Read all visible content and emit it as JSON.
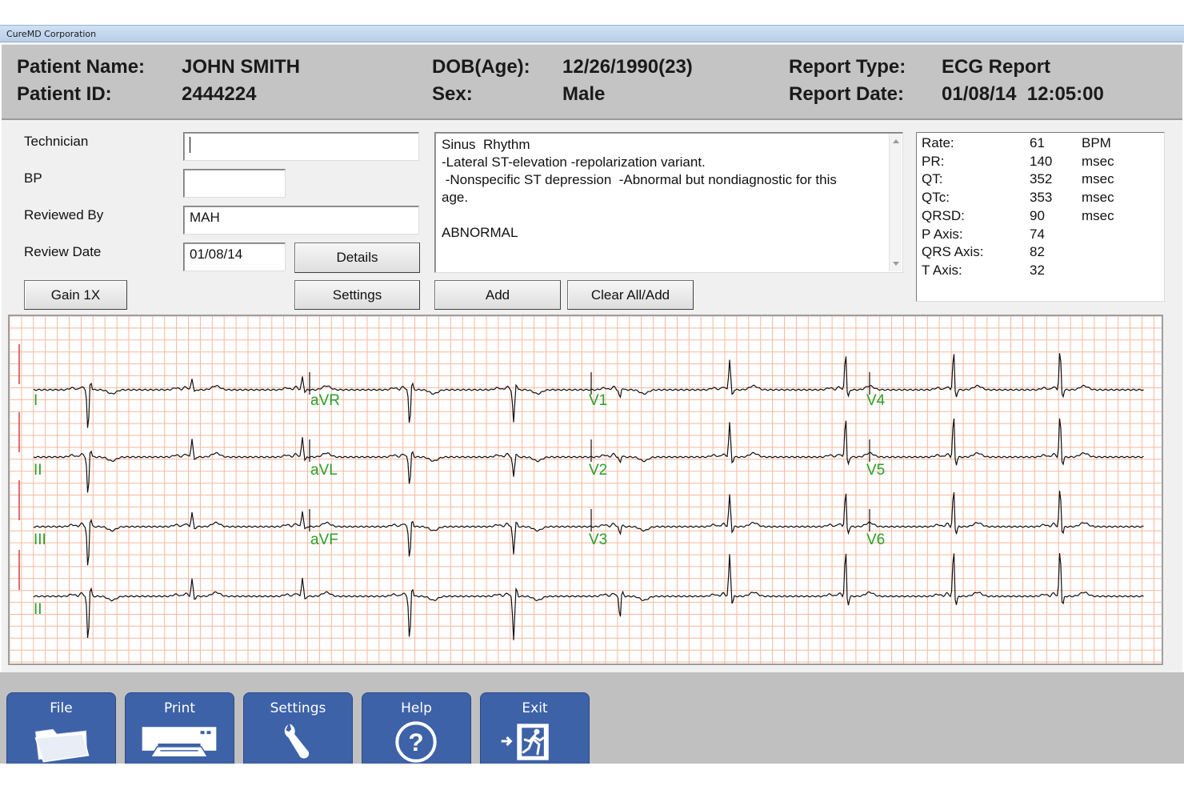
{
  "window": {
    "title": "CureMD Corporation"
  },
  "header": {
    "patient_name_label": "Patient Name:",
    "patient_name": "JOHN SMITH",
    "patient_id_label": "Patient ID:",
    "patient_id": "2444224",
    "dob_label": "DOB(Age):",
    "dob": "12/26/1990(23)",
    "sex_label": "Sex:",
    "sex": "Male",
    "report_type_label": "Report Type:",
    "report_type": "ECG Report",
    "report_date_label": "Report Date:",
    "report_date": "01/08/14  12:05:00"
  },
  "form": {
    "technician_label": "Technician",
    "technician_value": "",
    "bp_label": "BP",
    "bp_value": "",
    "reviewed_by_label": "Reviewed By",
    "reviewed_by_value": "MAH",
    "review_date_label": "Review Date",
    "review_date_value": "01/08/14"
  },
  "buttons": {
    "details": "Details",
    "gain": "Gain 1X",
    "settings": "Settings",
    "add": "Add",
    "clear_all_add": "Clear All/Add"
  },
  "interpretation": {
    "lines": [
      "Sinus  Rhythm",
      "-Lateral ST-elevation -repolarization variant.",
      " -Nonspecific ST depression  -Abnormal but nondiagnostic for this",
      "age.",
      "",
      "ABNORMAL"
    ]
  },
  "measurements": [
    {
      "label": "Rate:",
      "value": "61",
      "unit": "BPM"
    },
    {
      "label": "PR:",
      "value": "140",
      "unit": "msec"
    },
    {
      "label": "QT:",
      "value": "352",
      "unit": "msec"
    },
    {
      "label": "QTc:",
      "value": "353",
      "unit": "msec"
    },
    {
      "label": "QRSD:",
      "value": "90",
      "unit": "msec"
    },
    {
      "label": "P Axis:",
      "value": "74",
      "unit": ""
    },
    {
      "label": "QRS Axis:",
      "value": "82",
      "unit": ""
    },
    {
      "label": "T Axis:",
      "value": "32",
      "unit": ""
    }
  ],
  "ecg": {
    "grid_color": "#f3b9a1",
    "trace_color": "#111111",
    "label_color": "#2aa02a",
    "calibration_color": "#d04040",
    "lead_labels": [
      "I",
      "aVR",
      "V1",
      "V4",
      "II",
      "aVL",
      "V2",
      "V5",
      "III",
      "aVF",
      "V3",
      "V6",
      "II"
    ]
  },
  "toolbar": {
    "items": [
      {
        "label": "File",
        "icon": "folder-icon"
      },
      {
        "label": "Print",
        "icon": "printer-icon"
      },
      {
        "label": "Settings",
        "icon": "wrench-icon"
      },
      {
        "label": "Help",
        "icon": "help-icon"
      },
      {
        "label": "Exit",
        "icon": "exit-icon"
      }
    ],
    "color": "#3d62a8"
  }
}
